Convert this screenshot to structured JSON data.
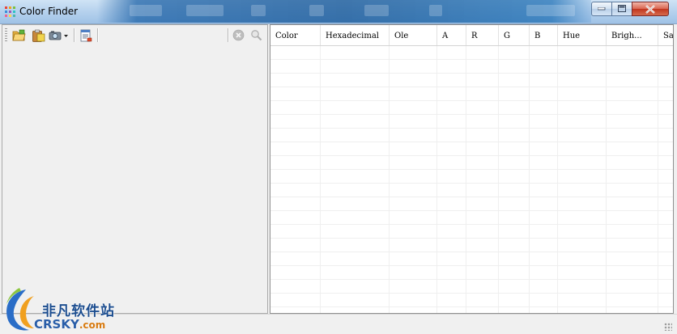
{
  "window": {
    "title": "Color Finder",
    "controls": {
      "minimize": "minimize",
      "maximize": "maximize",
      "close": "close"
    }
  },
  "toolbar": {
    "buttons": [
      {
        "name": "open-folder",
        "icon": "open-folder-icon"
      },
      {
        "name": "paste",
        "icon": "clipboard-icon"
      },
      {
        "name": "capture-dropdown",
        "icon": "capture-icon"
      },
      {
        "name": "report",
        "icon": "report-icon"
      },
      {
        "name": "clear",
        "icon": "clear-icon",
        "enabled": false
      },
      {
        "name": "zoom",
        "icon": "magnifier-icon",
        "enabled": false
      }
    ]
  },
  "grid": {
    "columns": [
      {
        "label": "Color"
      },
      {
        "label": "Hexadecimal"
      },
      {
        "label": "Ole"
      },
      {
        "label": "A"
      },
      {
        "label": "R"
      },
      {
        "label": "G"
      },
      {
        "label": "B"
      },
      {
        "label": "Hue"
      },
      {
        "label": "Brigh..."
      },
      {
        "label": "Sa"
      }
    ],
    "rows": []
  },
  "watermark": {
    "cn": "非凡软件站",
    "en_main": "CRSKY",
    "en_suffix": ".com"
  },
  "colors": {
    "title_accent": "#1f5fa5",
    "close_button": "#c1361f",
    "watermark_blue": "#1c4d8f",
    "watermark_orange": "#d77a10"
  }
}
